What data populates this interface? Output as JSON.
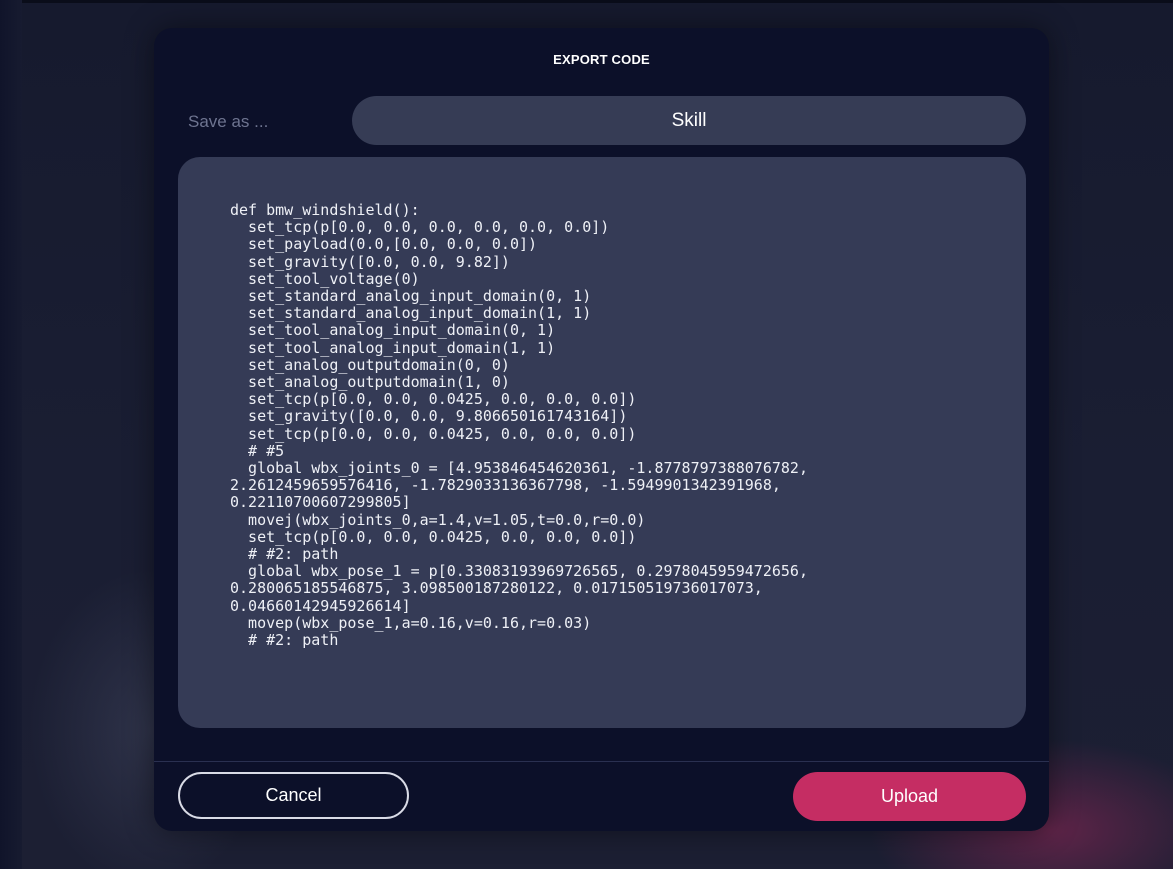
{
  "dialog": {
    "title": "EXPORT CODE",
    "save_as_label": "Save as ...",
    "name_field_value": "Skill",
    "code": "def bmw_windshield():\n  set_tcp(p[0.0, 0.0, 0.0, 0.0, 0.0, 0.0])\n  set_payload(0.0,[0.0, 0.0, 0.0])\n  set_gravity([0.0, 0.0, 9.82])\n  set_tool_voltage(0)\n  set_standard_analog_input_domain(0, 1)\n  set_standard_analog_input_domain(1, 1)\n  set_tool_analog_input_domain(0, 1)\n  set_tool_analog_input_domain(1, 1)\n  set_analog_outputdomain(0, 0)\n  set_analog_outputdomain(1, 0)\n  set_tcp(p[0.0, 0.0, 0.0425, 0.0, 0.0, 0.0])\n  set_gravity([0.0, 0.0, 9.806650161743164])\n  set_tcp(p[0.0, 0.0, 0.0425, 0.0, 0.0, 0.0])\n  # #5\n  global wbx_joints_0 = [4.953846454620361, -1.8778797388076782,\n2.2612459659576416, -1.7829033136367798, -1.5949901342391968,\n0.22110700607299805]\n  movej(wbx_joints_0,a=1.4,v=1.05,t=0.0,r=0.0)\n  set_tcp(p[0.0, 0.0, 0.0425, 0.0, 0.0, 0.0])\n  # #2: path\n  global wbx_pose_1 = p[0.33083193969726565, 0.2978045959472656,\n0.280065185546875, 3.098500187280122, 0.017150519736017073,\n0.04660142945926614]\n  movep(wbx_pose_1,a=0.16,v=0.16,r=0.03)\n  # #2: path",
    "cancel_label": "Cancel",
    "upload_label": "Upload"
  },
  "colors": {
    "dialog_bg": "#0c1029",
    "panel_bg": "#353b56",
    "accent": "#c52d63"
  }
}
